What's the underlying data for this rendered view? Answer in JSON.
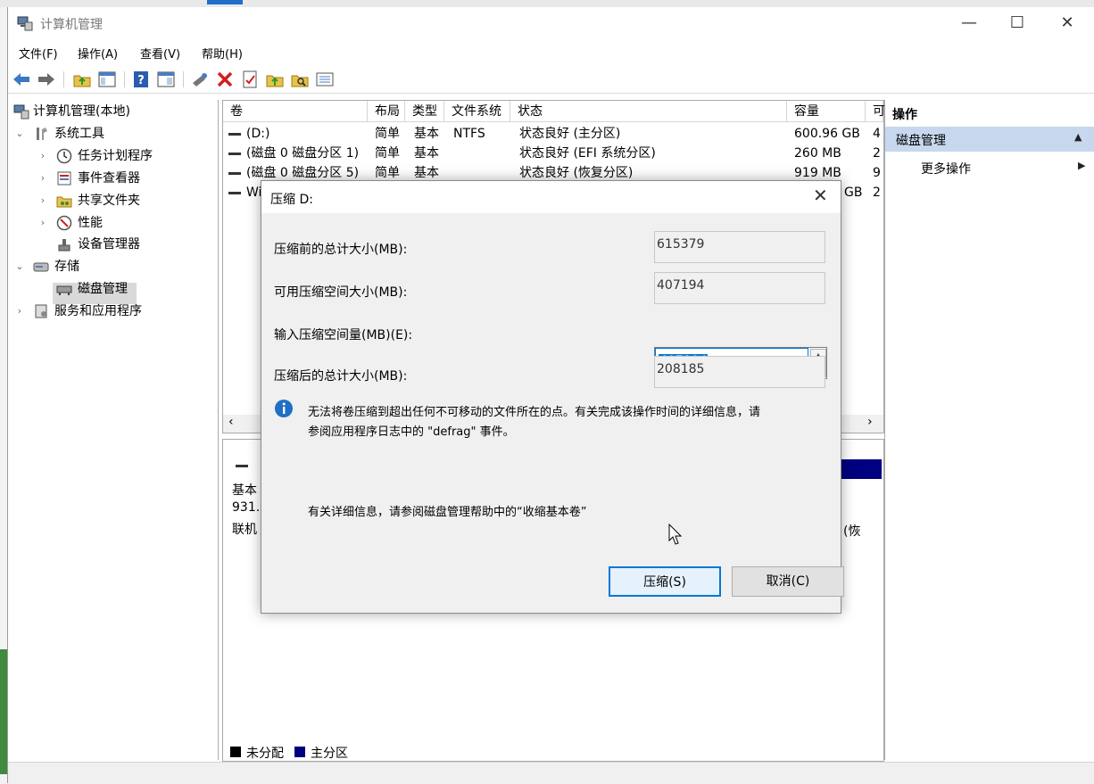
{
  "window": {
    "title": "计算机管理",
    "controls": {
      "minimize": "—",
      "maximize": "☐",
      "close": "✕"
    }
  },
  "menu": [
    "文件(F)",
    "操作(A)",
    "查看(V)",
    "帮助(H)"
  ],
  "toolbar_icons": [
    "back-arrow-icon",
    "forward-arrow-icon",
    "up-folder-icon",
    "show-hide-tree-icon",
    "help-icon",
    "show-hide-pane-icon",
    "connect-icon",
    "delete-icon",
    "properties-icon",
    "refresh-folder-icon",
    "search-folder-icon",
    "list-view-icon"
  ],
  "tree": {
    "root": "计算机管理(本地)",
    "system_tools": "系统工具",
    "task_scheduler": "任务计划程序",
    "event_viewer": "事件查看器",
    "shared_folders": "共享文件夹",
    "performance": "性能",
    "device_manager": "设备管理器",
    "storage": "存储",
    "disk_management": "磁盘管理",
    "services_apps": "服务和应用程序"
  },
  "volume_list": {
    "columns": [
      "卷",
      "布局",
      "类型",
      "文件系统",
      "状态",
      "容量",
      "可"
    ],
    "rows": [
      {
        "volume": "(D:)",
        "layout": "简单",
        "type": "基本",
        "fs": "NTFS",
        "status": "状态良好 (主分区)",
        "capacity": "600.96 GB",
        "free": "4"
      },
      {
        "volume": "(磁盘 0 磁盘分区 1)",
        "layout": "简单",
        "type": "基本",
        "fs": "",
        "status": "状态良好 (EFI 系统分区)",
        "capacity": "260 MB",
        "free": "2"
      },
      {
        "volume": "(磁盘 0 磁盘分区 5)",
        "layout": "简单",
        "type": "基本",
        "fs": "",
        "status": "状态良好 (恢复分区)",
        "capacity": "919 MB",
        "free": "9"
      },
      {
        "volume": "Wi",
        "layout": "",
        "type": "",
        "fs": "",
        "status": "",
        "capacity": "GB",
        "free": "2"
      }
    ]
  },
  "disk_graph": {
    "disk_lines": [
      "基本",
      "931.",
      "联机"
    ],
    "partition_fragment": "(恢",
    "legend": [
      "未分配",
      "主分区"
    ],
    "colors": {
      "unallocated": "#000000",
      "primary": "#000080"
    }
  },
  "actions": {
    "header": "操作",
    "section": "磁盘管理",
    "more": "更多操作"
  },
  "dialog": {
    "title": "压缩 D:",
    "total_before_label": "压缩前的总计大小(MB):",
    "total_before_value": "615379",
    "available_label": "可用压缩空间大小(MB):",
    "available_value": "407194",
    "input_label": "输入压缩空间量(MB)(E):",
    "input_value": "407194",
    "total_after_label": "压缩后的总计大小(MB):",
    "total_after_value": "208185",
    "info_text_line1": "无法将卷压缩到超出任何不可移动的文件所在的点。有关完成该操作时间的详细信息，请",
    "info_text_line2": "参阅应用程序日志中的 \"defrag\" 事件。",
    "help_text": "有关详细信息，请参阅磁盘管理帮助中的“收缩基本卷”",
    "shrink_button": "压缩(S)",
    "cancel_button": "取消(C)",
    "accent_color": "#0078d7"
  }
}
